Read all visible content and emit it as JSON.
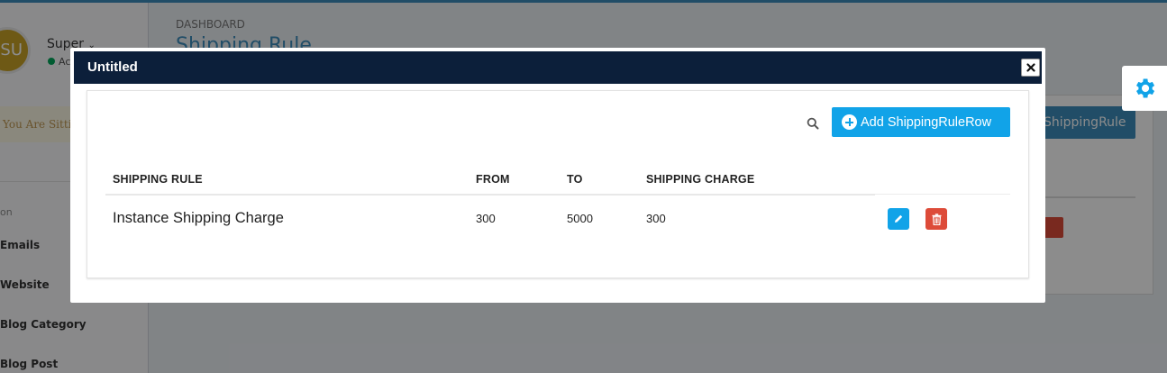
{
  "background": {
    "user": {
      "initials": "SU",
      "name": "Super",
      "status": "Ac"
    },
    "warning": "You Are Sitting",
    "sidebar": {
      "header": "on",
      "items": [
        {
          "label": "Emails"
        },
        {
          "label": "Website"
        },
        {
          "label": "Blog Category"
        },
        {
          "label": "Blog Post"
        }
      ]
    },
    "breadcrumb": "DASHBOARD",
    "page_title": "Shipping Rule",
    "add_button_label": "ShippingRule"
  },
  "modal": {
    "title": "Untitled",
    "add_button_label": "Add ShippingRuleRow",
    "table": {
      "columns": [
        "SHIPPING RULE",
        "FROM",
        "TO",
        "SHIPPING CHARGE"
      ],
      "rows": [
        {
          "shipping_rule": "Instance Shipping Charge",
          "from": "300",
          "to": "5000",
          "shipping_charge": "300"
        }
      ]
    }
  },
  "colors": {
    "modal_header": "#0c1f3a",
    "primary": "#11a3e8",
    "danger": "#dd4b39",
    "gear": "#11a3e8"
  },
  "icons": [
    "close-icon",
    "search-icon",
    "plus-circle-icon",
    "pencil-icon",
    "trash-icon",
    "gear-icon"
  ]
}
